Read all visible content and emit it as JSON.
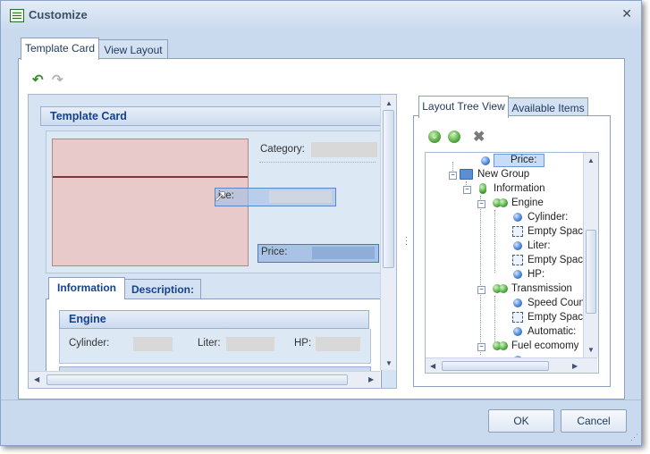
{
  "window": {
    "title": "Customize"
  },
  "tabs": [
    "Template Card",
    "View Layout"
  ],
  "designer": {
    "group_title": "Template Card",
    "category_label": "Category:",
    "drag_label": "ice:",
    "price_label": "Price:",
    "inner_tabs": [
      "Information",
      "Description:"
    ],
    "engine": {
      "title": "Engine",
      "cylinder_label": "Cylinder:",
      "liter_label": "Liter:",
      "hp_label": "HP:"
    }
  },
  "tree_tabs": [
    "Layout Tree View",
    "Available Items"
  ],
  "tree": {
    "selected": "Price:",
    "new_group": "New Group",
    "information": "Information",
    "engine": "Engine",
    "cylinder": "Cylinder:",
    "empty1": "Empty Space",
    "liter": "Liter:",
    "empty2": "Empty Space",
    "hp": "HP:",
    "transmission": "Transmission",
    "speed": "Speed Count",
    "empty3": "Empty Space",
    "automatic": "Automatic:",
    "fuel": "Fuel ecomomy"
  },
  "buttons": {
    "ok": "OK",
    "cancel": "Cancel"
  },
  "icons": {
    "undo": "undo-arrow-icon",
    "redo": "redo-arrow-icon",
    "expand": "expand-all-icon",
    "collapse": "collapse-all-icon",
    "delete": "delete-x-icon"
  }
}
